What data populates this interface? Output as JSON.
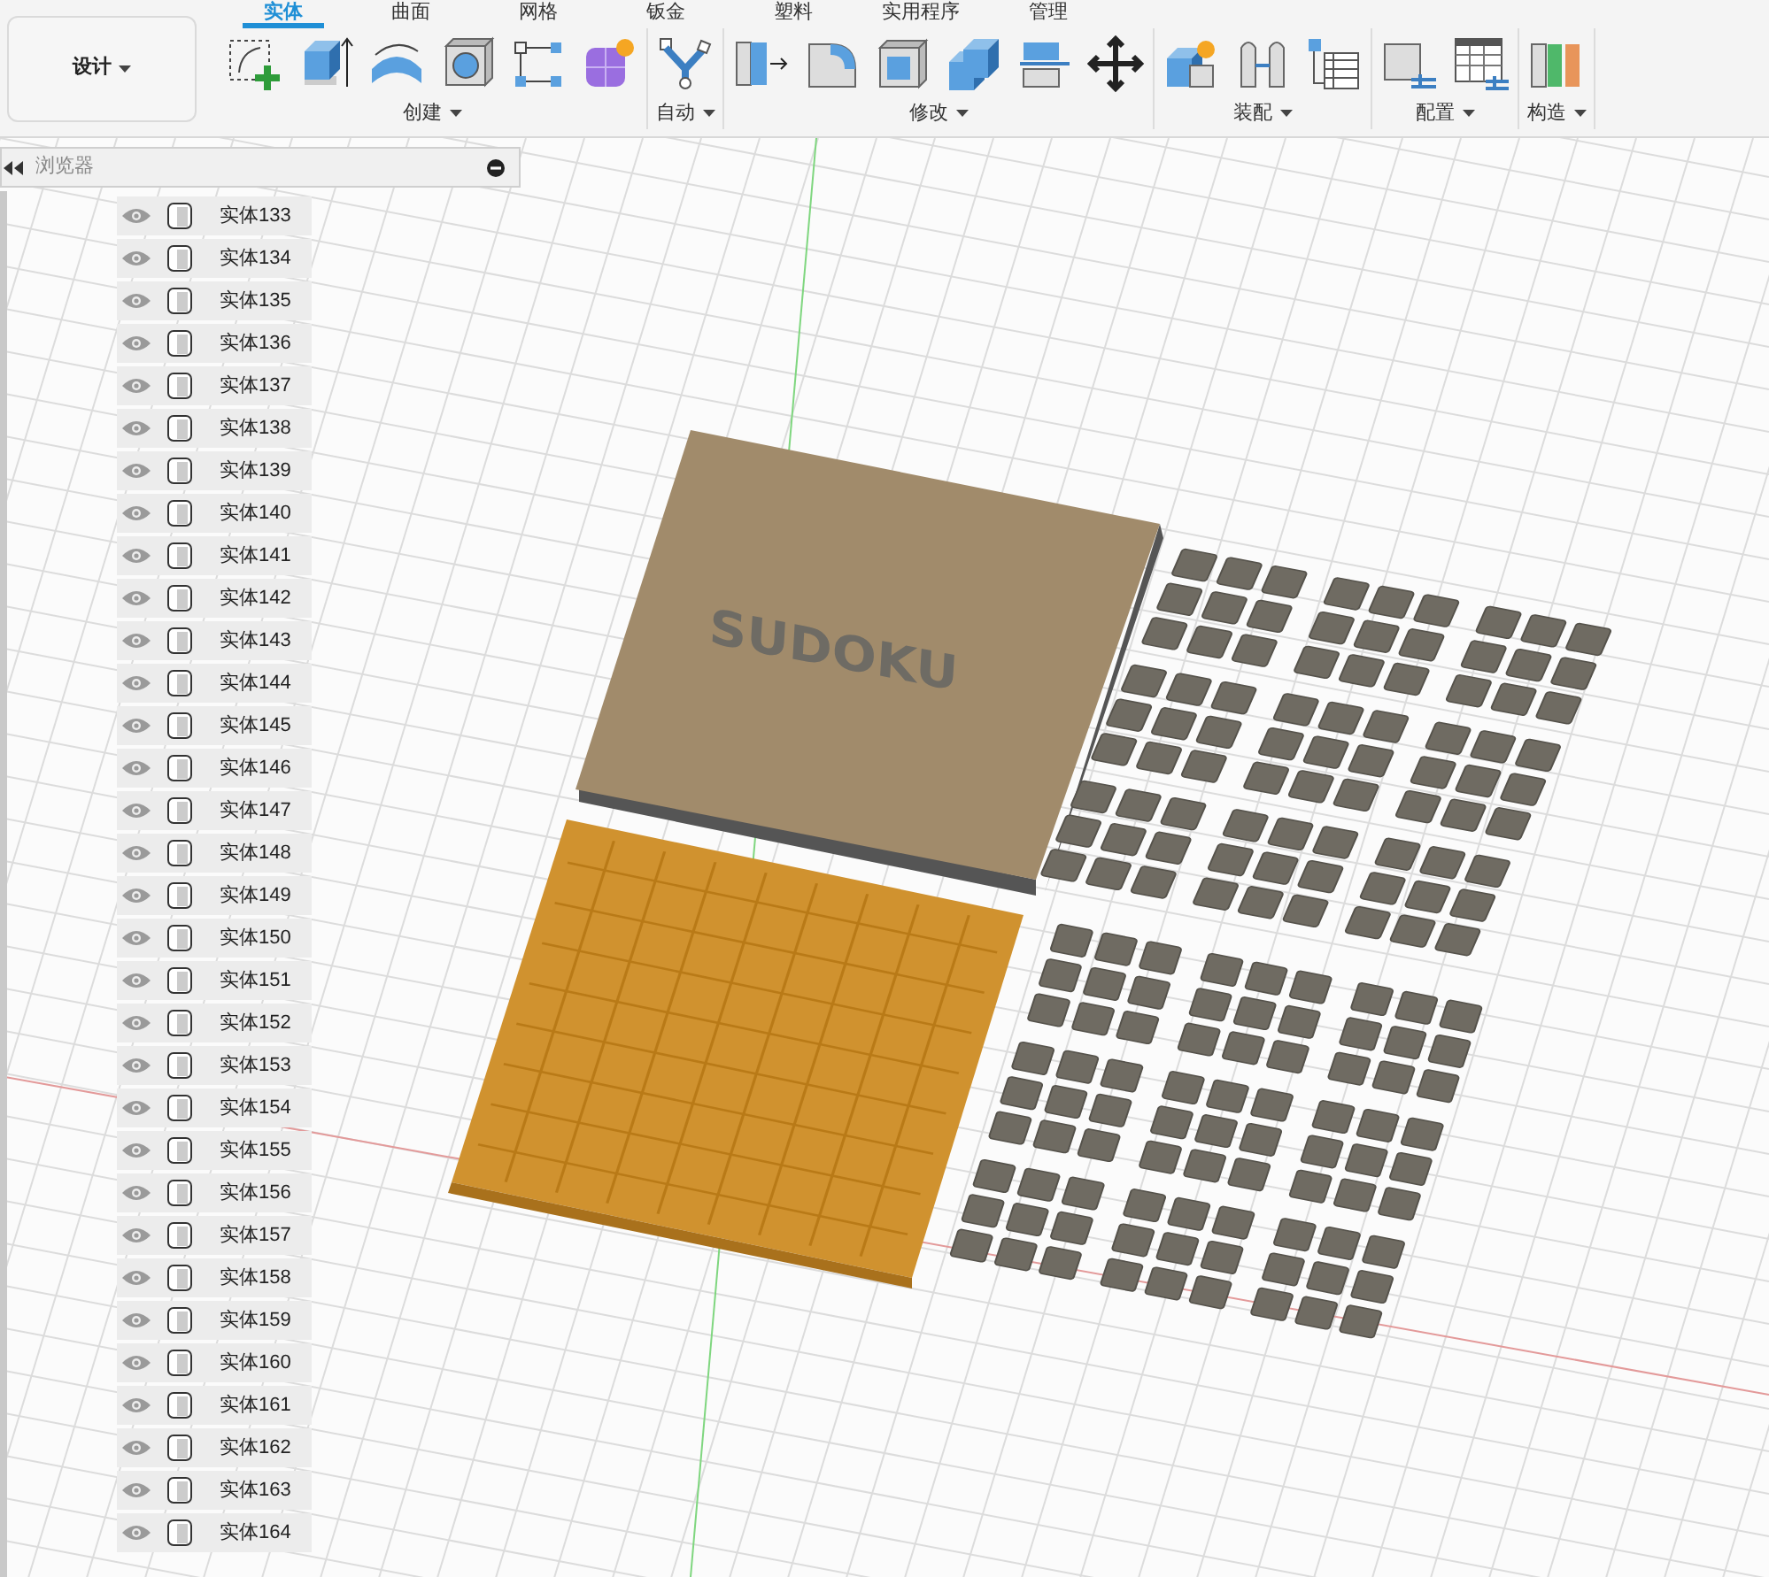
{
  "workspace": {
    "label": "设计"
  },
  "tabs": [
    {
      "label": "实体",
      "selected": true
    },
    {
      "label": "曲面",
      "selected": false
    },
    {
      "label": "网格",
      "selected": false
    },
    {
      "label": "钣金",
      "selected": false
    },
    {
      "label": "塑料",
      "selected": false
    },
    {
      "label": "实用程序",
      "selected": false
    },
    {
      "label": "管理",
      "selected": false
    }
  ],
  "tool_groups": [
    {
      "label": "创建",
      "kind": "create"
    },
    {
      "label": "自动",
      "kind": "automate"
    },
    {
      "label": "修改",
      "kind": "modify"
    },
    {
      "label": "装配",
      "kind": "assemble"
    },
    {
      "label": "配置",
      "kind": "configure"
    },
    {
      "label": "构造",
      "kind": "construct"
    }
  ],
  "browser": {
    "title": "浏览器",
    "items": [
      {
        "label": "实体133"
      },
      {
        "label": "实体134"
      },
      {
        "label": "实体135"
      },
      {
        "label": "实体136"
      },
      {
        "label": "实体137"
      },
      {
        "label": "实体138"
      },
      {
        "label": "实体139"
      },
      {
        "label": "实体140"
      },
      {
        "label": "实体141"
      },
      {
        "label": "实体142"
      },
      {
        "label": "实体143"
      },
      {
        "label": "实体144"
      },
      {
        "label": "实体145"
      },
      {
        "label": "实体146"
      },
      {
        "label": "实体147"
      },
      {
        "label": "实体148"
      },
      {
        "label": "实体149"
      },
      {
        "label": "实体150"
      },
      {
        "label": "实体151"
      },
      {
        "label": "实体152"
      },
      {
        "label": "实体153"
      },
      {
        "label": "实体154"
      },
      {
        "label": "实体155"
      },
      {
        "label": "实体156"
      },
      {
        "label": "实体157"
      },
      {
        "label": "实体158"
      },
      {
        "label": "实体159"
      },
      {
        "label": "实体160"
      },
      {
        "label": "实体161"
      },
      {
        "label": "实体162"
      },
      {
        "label": "实体163"
      },
      {
        "label": "实体164"
      }
    ]
  },
  "model": {
    "lid_text": "SUDOKU"
  }
}
